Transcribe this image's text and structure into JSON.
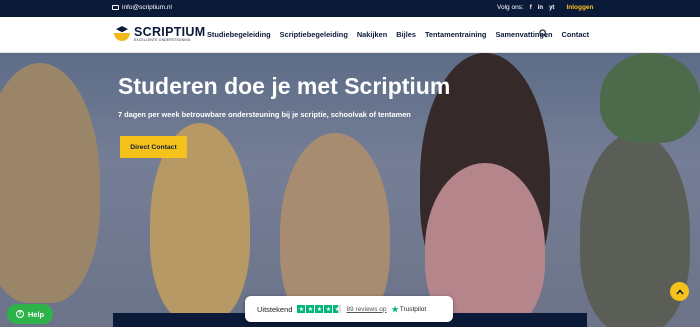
{
  "topbar": {
    "email": "info@scriptium.nl",
    "follow_label": "Volg ons:",
    "social": [
      "f",
      "in",
      "yt"
    ],
    "login_label": "Inloggen"
  },
  "logo": {
    "name": "SCRIPTIUM",
    "tagline": "EXCELLENTE ONDERSTEUNING"
  },
  "menu": [
    "Studiebegeleiding",
    "Scriptiebegeleiding",
    "Nakijken",
    "Bijles",
    "Tentamentraining",
    "Samenvattingen",
    "Contact"
  ],
  "hero": {
    "title": "Studeren doe je met Scriptium",
    "tagline": "7 dagen per week betrouwbare ondersteuning bij je scriptie, schoolvak of tentamen",
    "cta_label": "Direct Contact"
  },
  "help": {
    "label": "Help"
  },
  "trustpilot": {
    "rating_label": "Uitstekend",
    "stars": 4.5,
    "reviews_label": "89 reviews op",
    "brand": "Trustpilot"
  },
  "colors": {
    "navy": "#0c1a3a",
    "yellow": "#f5c21b",
    "green": "#2db34a",
    "trustpilot_green": "#00b67a"
  }
}
